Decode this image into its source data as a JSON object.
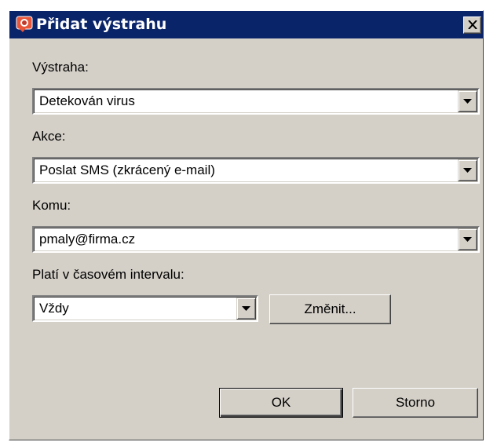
{
  "dialog": {
    "title": "Přidat výstrahu",
    "close_symbol": "✕",
    "alert": {
      "label": "Výstraha:",
      "value": "Detekován virus"
    },
    "action": {
      "label": "Akce:",
      "value": "Poslat SMS (zkrácený e-mail)"
    },
    "recipient": {
      "label": "Komu:",
      "value": "pmaly@firma.cz"
    },
    "interval": {
      "label": "Platí v časovém intervalu:",
      "value": "Vždy",
      "change_button": "Změnit..."
    },
    "ok_button": "OK",
    "cancel_button": "Storno"
  },
  "icons": {
    "title": "app-alert-icon",
    "close": "close-icon",
    "dropdown": "chevron-down-icon"
  },
  "colors": {
    "titlebar": "#0a246a",
    "face": "#d4d0c8",
    "title_text": "#ffffff"
  }
}
